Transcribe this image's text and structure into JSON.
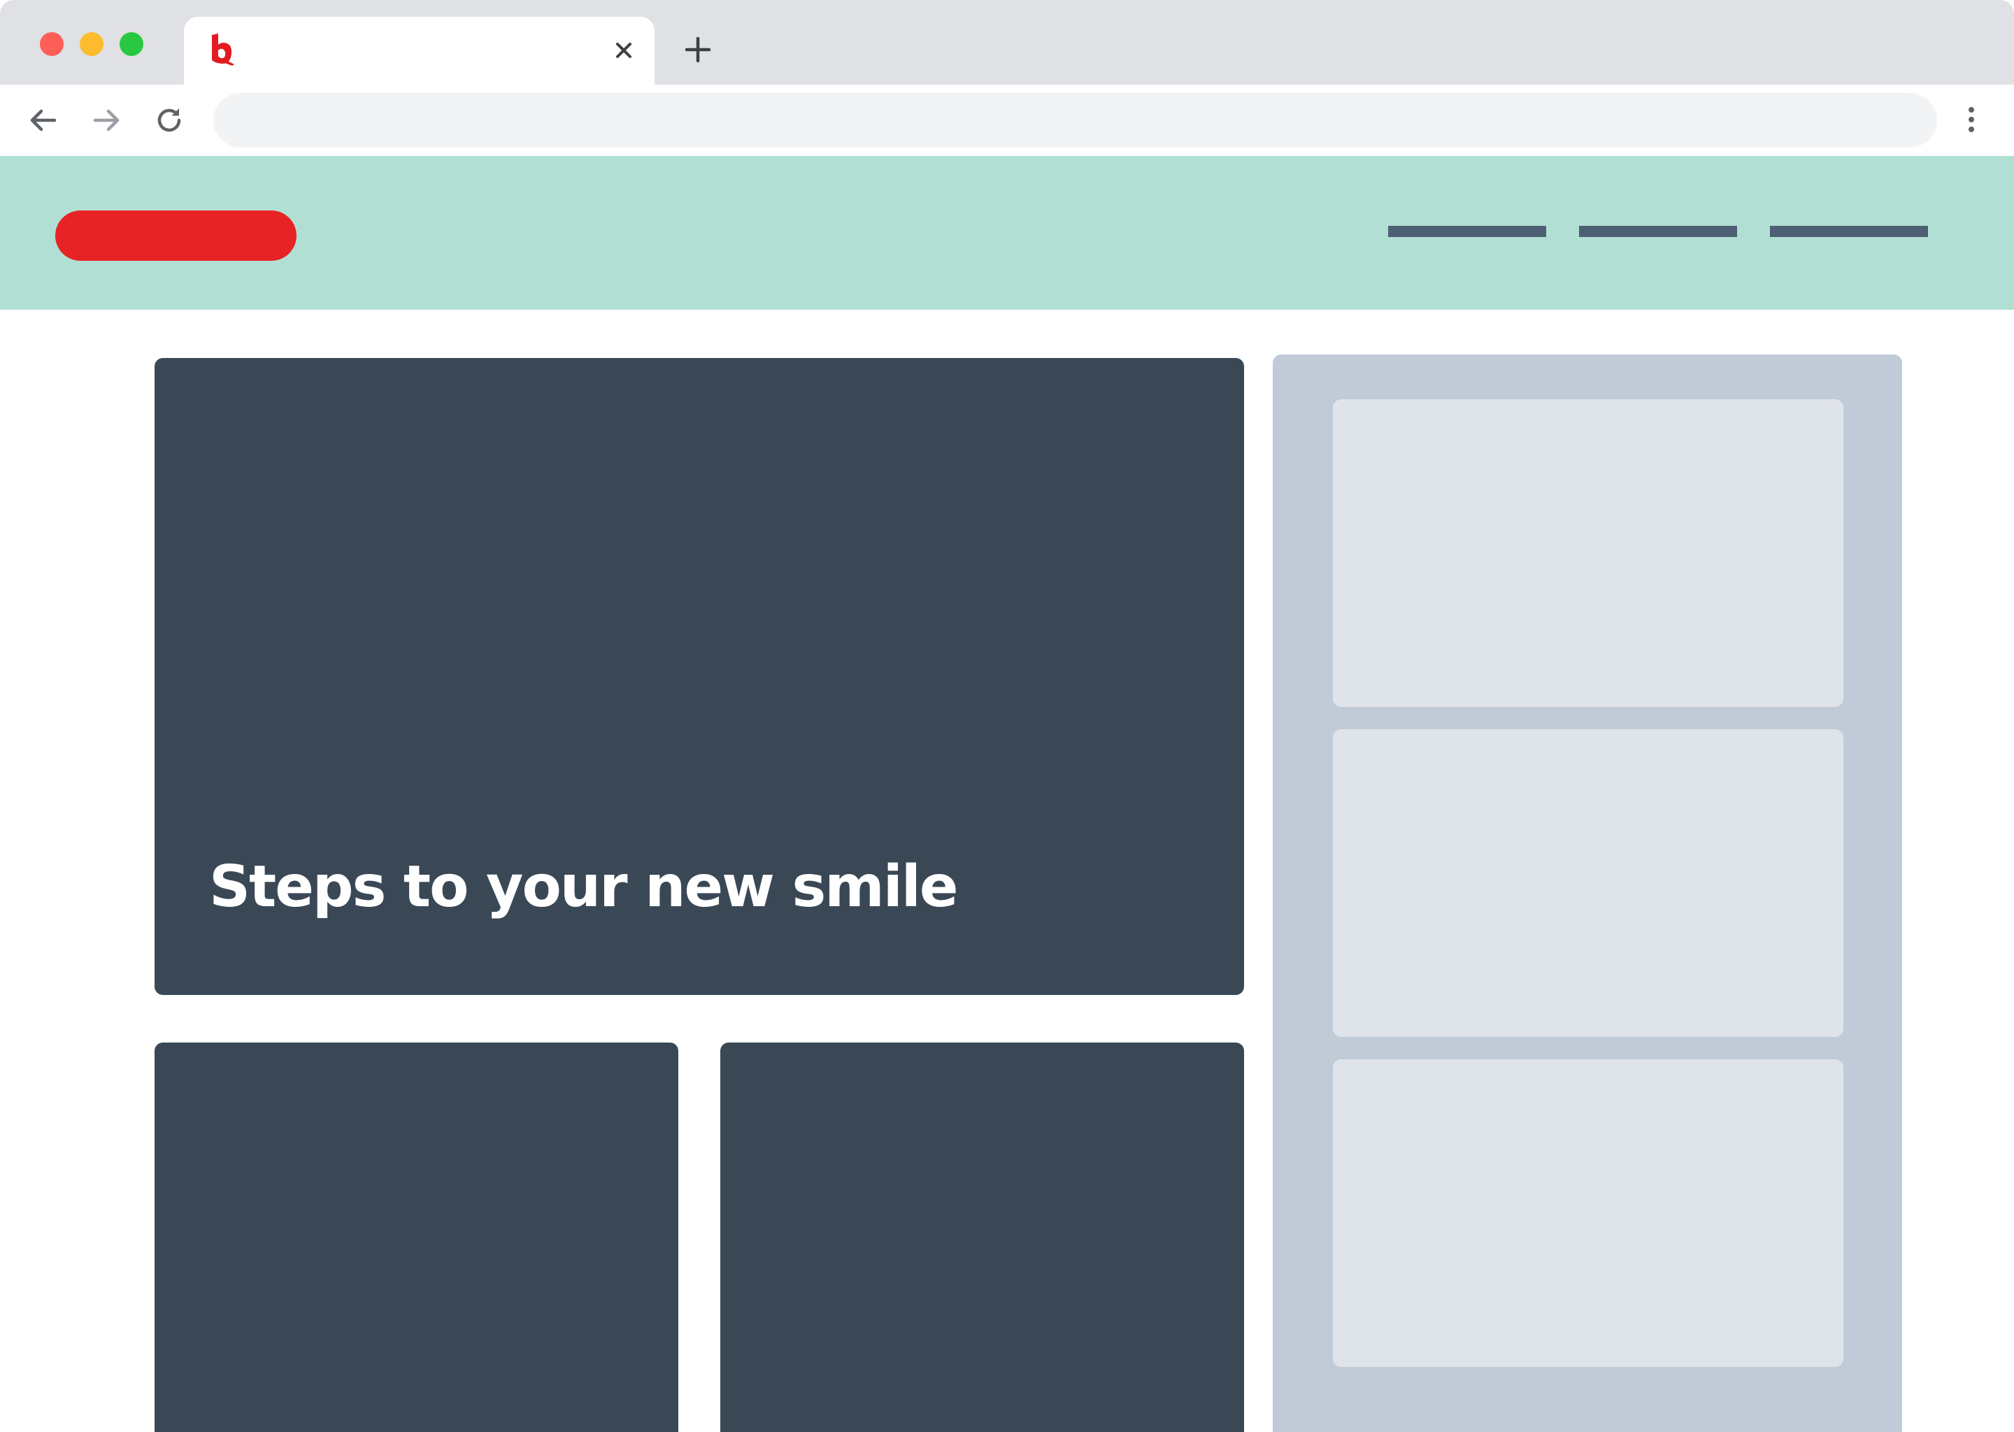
{
  "browser": {
    "tab": {
      "title": ""
    },
    "address_bar": {
      "value": "",
      "placeholder": ""
    }
  },
  "icons": {
    "favicon": "red-b-logo-icon",
    "close_tab": "close-icon",
    "new_tab": "plus-icon",
    "back": "arrow-left-icon",
    "forward": "arrow-right-icon",
    "reload": "reload-icon",
    "menu": "kebab-menu-icon"
  },
  "site": {
    "hero": {
      "title": "Steps to your new smile"
    }
  },
  "colors": {
    "header_bg": "#b2dfd4",
    "brand_red": "#e72325",
    "nav_placeholder": "#4d5f73",
    "card_dark": "#3a4856",
    "sidebar_bg": "#c1cbd7",
    "sidebar_card": "#dfe3ea"
  }
}
